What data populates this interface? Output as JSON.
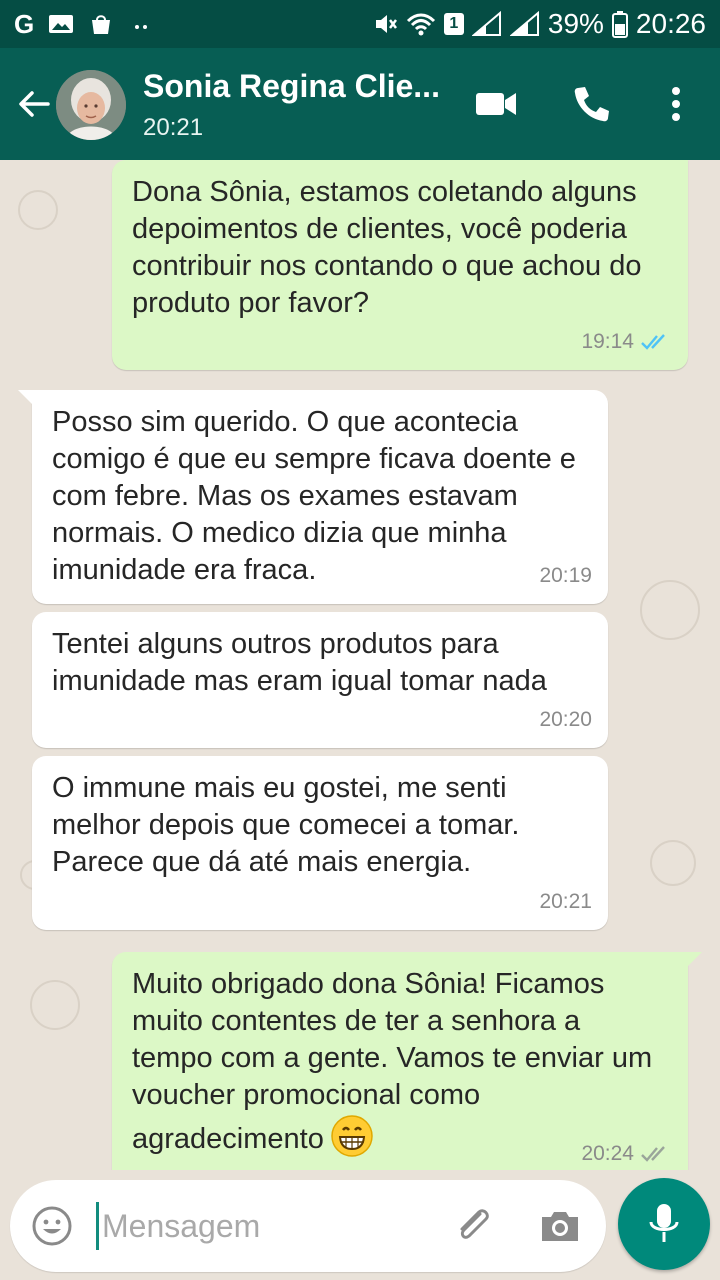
{
  "status_bar": {
    "left_letter": "G",
    "battery": "39%",
    "time": "20:26",
    "sim_slot": "1"
  },
  "header": {
    "contact_name": "Sonia Regina Clie...",
    "last_seen": "20:21"
  },
  "messages": [
    {
      "direction": "outgoing",
      "text": "Dona Sônia, estamos coletando alguns depoimentos de clientes, você poderia contribuir nos contando o que achou do produto por favor?",
      "time": "19:14",
      "status": "read"
    },
    {
      "direction": "incoming",
      "text": "Posso sim querido. O que acontecia comigo é que eu sempre ficava doente e com febre. Mas os exames estavam normais. O medico dizia que minha imunidade era fraca.",
      "time": "20:19"
    },
    {
      "direction": "incoming",
      "text": "Tentei alguns outros produtos para imunidade mas eram igual tomar nada",
      "time": "20:20"
    },
    {
      "direction": "incoming",
      "text": "O immune mais eu gostei, me senti melhor depois que comecei a tomar. Parece que dá até mais energia.",
      "time": "20:21"
    },
    {
      "direction": "outgoing",
      "text": "Muito obrigado dona Sônia! Ficamos muito contentes de ter a senhora a tempo com a gente. Vamos te enviar um voucher promocional como agradecimento",
      "emoji": "grinning-face",
      "time": "20:24",
      "status": "delivered"
    }
  ],
  "composer": {
    "placeholder": "Mensagem"
  },
  "colors": {
    "header": "#075e54",
    "status_bar": "#054d44",
    "outgoing_bubble": "#dcf8c6",
    "incoming_bubble": "#ffffff",
    "read_ticks": "#4fc3f7",
    "fab": "#00897b"
  }
}
